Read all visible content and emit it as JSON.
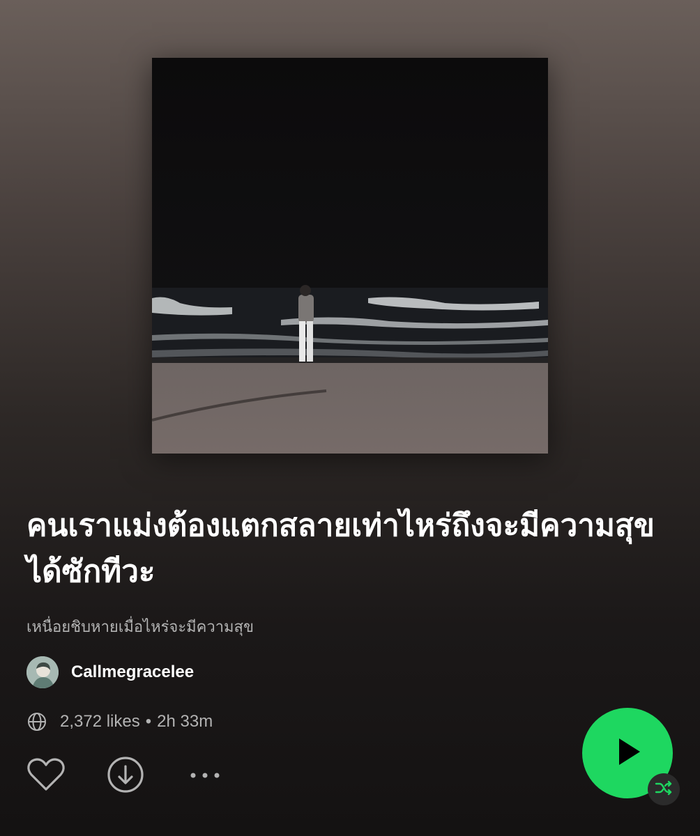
{
  "playlist": {
    "title": "คนเราแม่งต้องแตกสลายเท่าไหร่ถึงจะมีความสุขได้ซักทีวะ",
    "description": "เหนื่อยชิบหายเมื่อไหร่จะมีความสุข",
    "owner": "Callmegracelee",
    "likes": "2,372 likes",
    "separator": "•",
    "duration": "2h 33m"
  },
  "icons": {
    "globe": "globe-icon",
    "like": "heart-icon",
    "download": "download-icon",
    "more": "more-options-icon",
    "play": "play-icon",
    "shuffle": "shuffle-icon"
  },
  "colors": {
    "accent": "#1ed760",
    "text_primary": "#ffffff",
    "text_secondary": "#b3b3b3"
  }
}
